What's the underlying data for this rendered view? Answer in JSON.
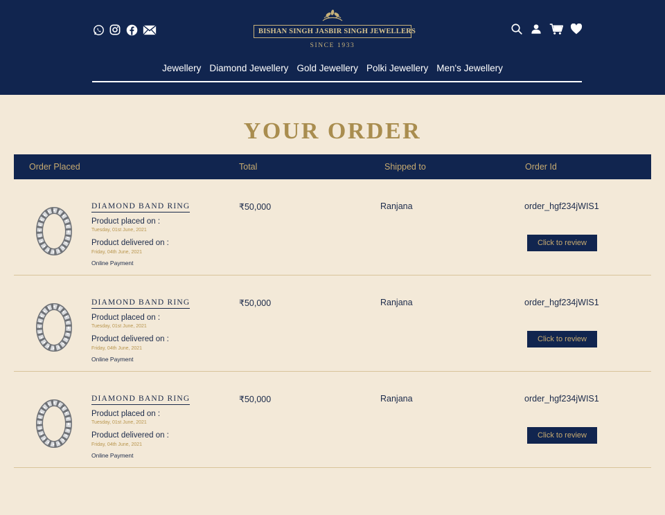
{
  "brand": {
    "name": "BISHAN SINGH JASBIR SINGH JEWELLERS",
    "since": "SINCE 1933"
  },
  "social_icons": [
    "whatsapp-icon",
    "instagram-icon",
    "facebook-icon",
    "mail-icon"
  ],
  "utility_icons": [
    "search-icon",
    "user-icon",
    "cart-icon",
    "heart-icon"
  ],
  "nav": [
    "Jewellery",
    "Diamond Jewellery",
    "Gold Jewellery",
    "Polki Jewellery",
    "Men's Jewellery"
  ],
  "page": {
    "title": "YOUR ORDER"
  },
  "table": {
    "headers": {
      "placed": "Order Placed",
      "total": "Total",
      "shipped": "Shipped to",
      "order_id": "Order Id"
    }
  },
  "orders": [
    {
      "name": "DIAMOND BAND RING",
      "placed_label": "Product placed on :",
      "placed_date": "Tuesday, 01st June, 2021",
      "delivered_label": "Product delivered on :",
      "delivered_date": "Friday, 04th June, 2021",
      "payment": "Online Payment",
      "price": "₹50,000",
      "shipped_to": "Ranjana",
      "order_id": "order_hgf234jWIS1",
      "review_label": "Click to review"
    },
    {
      "name": "DIAMOND BAND RING",
      "placed_label": "Product placed on :",
      "placed_date": "Tuesday, 01st June, 2021",
      "delivered_label": "Product delivered on :",
      "delivered_date": "Friday, 04th June, 2021",
      "payment": "Online Payment",
      "price": "₹50,000",
      "shipped_to": "Ranjana",
      "order_id": "order_hgf234jWIS1",
      "review_label": "Click to review"
    },
    {
      "name": "DIAMOND BAND RING",
      "placed_label": "Product placed on :",
      "placed_date": "Tuesday, 01st June, 2021",
      "delivered_label": "Product delivered on :",
      "delivered_date": "Friday, 04th June, 2021",
      "payment": "Online Payment",
      "price": "₹50,000",
      "shipped_to": "Ranjana",
      "order_id": "order_hgf234jWIS1",
      "review_label": "Click to review"
    }
  ],
  "colors": {
    "navy": "#11254f",
    "gold": "#a98d4f",
    "cream": "#f3e9d8"
  }
}
